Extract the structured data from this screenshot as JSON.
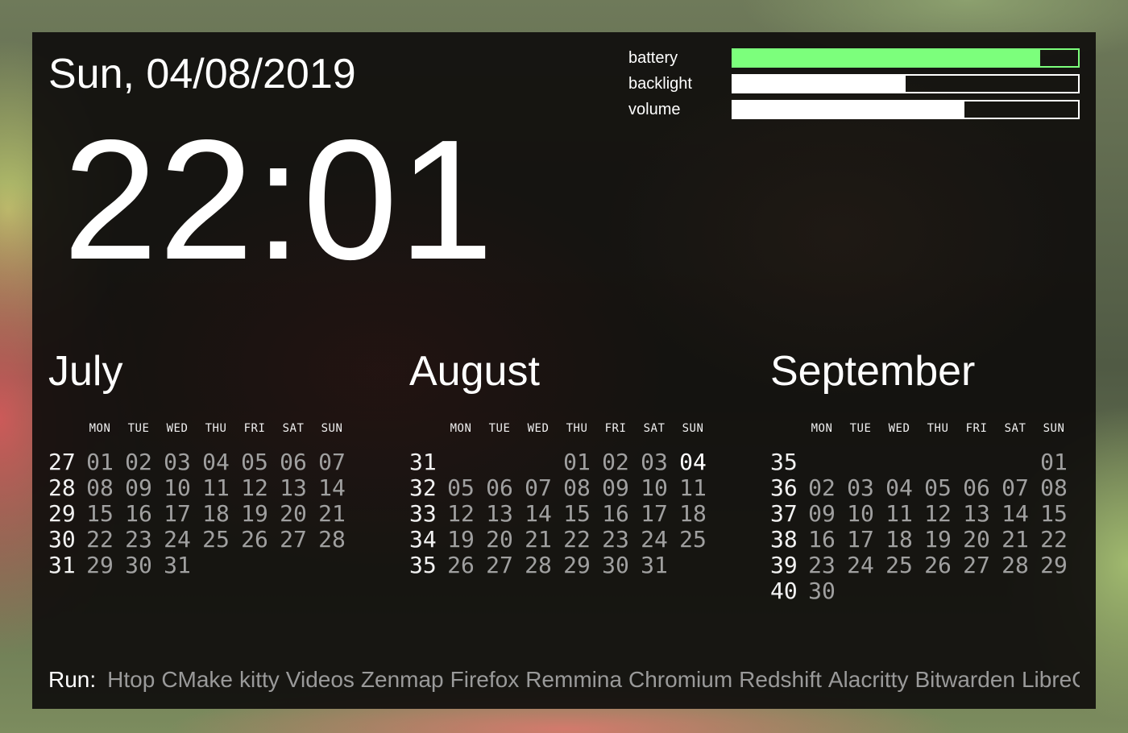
{
  "header": {
    "date": "Sun, 04/08/2019",
    "time": "22:01"
  },
  "meters": [
    {
      "label": "battery",
      "fraction": 0.89,
      "color": "#7cff7c"
    },
    {
      "label": "backlight",
      "fraction": 0.5,
      "color": "#ffffff"
    },
    {
      "label": "volume",
      "fraction": 0.67,
      "color": "#ffffff"
    }
  ],
  "calendar": {
    "weekdays": [
      "MON",
      "TUE",
      "WED",
      "THU",
      "FRI",
      "SAT",
      "SUN"
    ],
    "months": [
      {
        "name": "July",
        "rows": [
          {
            "week": "27",
            "days": [
              "01",
              "02",
              "03",
              "04",
              "05",
              "06",
              "07"
            ]
          },
          {
            "week": "28",
            "days": [
              "08",
              "09",
              "10",
              "11",
              "12",
              "13",
              "14"
            ]
          },
          {
            "week": "29",
            "days": [
              "15",
              "16",
              "17",
              "18",
              "19",
              "20",
              "21"
            ]
          },
          {
            "week": "30",
            "days": [
              "22",
              "23",
              "24",
              "25",
              "26",
              "27",
              "28"
            ]
          },
          {
            "week": "31",
            "days": [
              "29",
              "30",
              "31",
              "",
              "",
              "",
              ""
            ]
          }
        ]
      },
      {
        "name": "August",
        "today": "04",
        "rows": [
          {
            "week": "31",
            "days": [
              "",
              "",
              "",
              "01",
              "02",
              "03",
              "04"
            ]
          },
          {
            "week": "32",
            "days": [
              "05",
              "06",
              "07",
              "08",
              "09",
              "10",
              "11"
            ]
          },
          {
            "week": "33",
            "days": [
              "12",
              "13",
              "14",
              "15",
              "16",
              "17",
              "18"
            ]
          },
          {
            "week": "34",
            "days": [
              "19",
              "20",
              "21",
              "22",
              "23",
              "24",
              "25"
            ]
          },
          {
            "week": "35",
            "days": [
              "26",
              "27",
              "28",
              "29",
              "30",
              "31",
              ""
            ]
          }
        ]
      },
      {
        "name": "September",
        "rows": [
          {
            "week": "35",
            "days": [
              "",
              "",
              "",
              "",
              "",
              "",
              "01"
            ]
          },
          {
            "week": "36",
            "days": [
              "02",
              "03",
              "04",
              "05",
              "06",
              "07",
              "08"
            ]
          },
          {
            "week": "37",
            "days": [
              "09",
              "10",
              "11",
              "12",
              "13",
              "14",
              "15"
            ]
          },
          {
            "week": "38",
            "days": [
              "16",
              "17",
              "18",
              "19",
              "20",
              "21",
              "22"
            ]
          },
          {
            "week": "39",
            "days": [
              "23",
              "24",
              "25",
              "26",
              "27",
              "28",
              "29"
            ]
          },
          {
            "week": "40",
            "days": [
              "30",
              "",
              "",
              "",
              "",
              "",
              ""
            ]
          }
        ]
      }
    ]
  },
  "run": {
    "label": "Run:",
    "apps": [
      "Htop",
      "CMake",
      "kitty",
      "Videos",
      "Zenmap",
      "Firefox",
      "Remmina",
      "Chromium",
      "Redshift",
      "Alacritty",
      "Bitwarden",
      "LibreOff"
    ]
  }
}
